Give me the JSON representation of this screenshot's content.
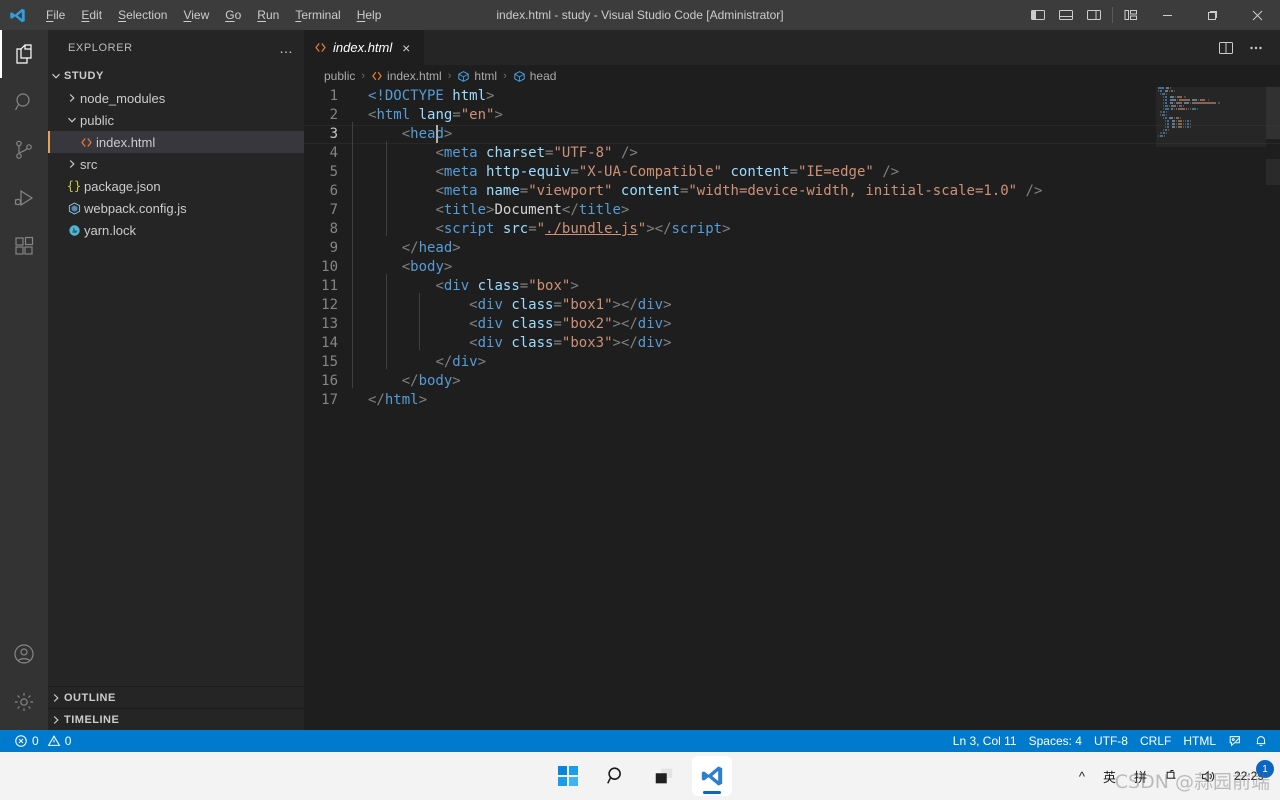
{
  "window": {
    "title": "index.html - study - Visual Studio Code [Administrator]",
    "logo": "vscode-logo"
  },
  "menu": {
    "items": [
      {
        "label": "File",
        "mnemonic": "F"
      },
      {
        "label": "Edit",
        "mnemonic": "E"
      },
      {
        "label": "Selection",
        "mnemonic": "S"
      },
      {
        "label": "View",
        "mnemonic": "V"
      },
      {
        "label": "Go",
        "mnemonic": "G"
      },
      {
        "label": "Run",
        "mnemonic": "R"
      },
      {
        "label": "Terminal",
        "mnemonic": "T"
      },
      {
        "label": "Help",
        "mnemonic": "H"
      }
    ]
  },
  "titlebar_actions": {
    "toggle_primary_sidebar": "toggle-primary-sidebar-icon",
    "toggle_panel": "toggle-panel-icon",
    "toggle_secondary_sidebar": "toggle-secondary-sidebar-icon",
    "customize_layout": "customize-layout-icon",
    "minimize": "minimize-icon",
    "maximize": "maximize-icon",
    "close": "close-icon"
  },
  "activitybar": {
    "items": [
      {
        "name": "explorer",
        "icon": "files-icon",
        "active": true
      },
      {
        "name": "search",
        "icon": "search-icon",
        "active": false
      },
      {
        "name": "source-control",
        "icon": "source-control-icon",
        "active": false
      },
      {
        "name": "run-and-debug",
        "icon": "run-debug-icon",
        "active": false
      },
      {
        "name": "extensions",
        "icon": "extensions-icon",
        "active": false
      }
    ],
    "bottom": [
      {
        "name": "accounts",
        "icon": "account-icon"
      },
      {
        "name": "settings",
        "icon": "gear-icon"
      }
    ]
  },
  "sidebar": {
    "header": "EXPLORER",
    "more_actions": "…",
    "tree": [
      {
        "label": "STUDY",
        "type": "root",
        "expanded": true,
        "indent": 0,
        "icon": "none",
        "selected": false
      },
      {
        "label": "node_modules",
        "type": "folder",
        "expanded": false,
        "indent": 1,
        "icon": "none",
        "selected": false
      },
      {
        "label": "public",
        "type": "folder",
        "expanded": true,
        "indent": 1,
        "icon": "none",
        "selected": false
      },
      {
        "label": "index.html",
        "type": "file",
        "expanded": null,
        "indent": 2,
        "icon": "html-icon",
        "selected": true
      },
      {
        "label": "src",
        "type": "folder",
        "expanded": false,
        "indent": 1,
        "icon": "none",
        "selected": false
      },
      {
        "label": "package.json",
        "type": "file",
        "expanded": null,
        "indent": 1,
        "icon": "json-icon",
        "selected": false
      },
      {
        "label": "webpack.config.js",
        "type": "file",
        "expanded": null,
        "indent": 1,
        "icon": "webpack-icon",
        "selected": false
      },
      {
        "label": "yarn.lock",
        "type": "file",
        "expanded": null,
        "indent": 1,
        "icon": "yarn-icon",
        "selected": false
      }
    ],
    "sections": [
      {
        "label": "OUTLINE",
        "expanded": false
      },
      {
        "label": "TIMELINE",
        "expanded": false
      }
    ]
  },
  "editor": {
    "tabs": [
      {
        "label": "index.html",
        "icon": "html-icon",
        "active": true,
        "preview": true,
        "close": "×"
      }
    ],
    "actions": [
      {
        "name": "split-editor-right",
        "icon": "split-editor-icon"
      },
      {
        "name": "more-actions",
        "icon": "ellipsis-icon"
      }
    ],
    "breadcrumbs": [
      {
        "label": "public",
        "icon": "none"
      },
      {
        "label": "index.html",
        "icon": "html-icon"
      },
      {
        "label": "html",
        "icon": "symbol-field-icon"
      },
      {
        "label": "head",
        "icon": "symbol-field-icon"
      }
    ],
    "code": {
      "language": "HTML",
      "cursor_line": 3,
      "lines": [
        {
          "n": 1,
          "indent": 0,
          "guides": 0,
          "tokens": [
            {
              "t": "<!DOCTYPE",
              "c": "t-doctype"
            },
            {
              "t": " ",
              "c": "t-txt"
            },
            {
              "t": "html",
              "c": "t-attr"
            },
            {
              "t": ">",
              "c": "t-punct"
            }
          ]
        },
        {
          "n": 2,
          "indent": 0,
          "guides": 0,
          "tokens": [
            {
              "t": "<",
              "c": "t-punct"
            },
            {
              "t": "html",
              "c": "t-tag"
            },
            {
              "t": " ",
              "c": "t-txt"
            },
            {
              "t": "lang",
              "c": "t-attr"
            },
            {
              "t": "=",
              "c": "t-punct"
            },
            {
              "t": "\"en\"",
              "c": "t-str"
            },
            {
              "t": ">",
              "c": "t-punct"
            }
          ]
        },
        {
          "n": 3,
          "indent": 4,
          "guides": 1,
          "tokens": [
            {
              "t": "<",
              "c": "t-punct"
            },
            {
              "t": "head",
              "c": "t-tag"
            },
            {
              "t": ">",
              "c": "t-punct"
            }
          ]
        },
        {
          "n": 4,
          "indent": 8,
          "guides": 2,
          "tokens": [
            {
              "t": "<",
              "c": "t-punct"
            },
            {
              "t": "meta",
              "c": "t-tag"
            },
            {
              "t": " ",
              "c": "t-txt"
            },
            {
              "t": "charset",
              "c": "t-attr"
            },
            {
              "t": "=",
              "c": "t-punct"
            },
            {
              "t": "\"UTF-8\"",
              "c": "t-str"
            },
            {
              "t": " ",
              "c": "t-txt"
            },
            {
              "t": "/>",
              "c": "t-punct"
            }
          ]
        },
        {
          "n": 5,
          "indent": 8,
          "guides": 2,
          "tokens": [
            {
              "t": "<",
              "c": "t-punct"
            },
            {
              "t": "meta",
              "c": "t-tag"
            },
            {
              "t": " ",
              "c": "t-txt"
            },
            {
              "t": "http-equiv",
              "c": "t-attr"
            },
            {
              "t": "=",
              "c": "t-punct"
            },
            {
              "t": "\"X-UA-Compatible\"",
              "c": "t-str"
            },
            {
              "t": " ",
              "c": "t-txt"
            },
            {
              "t": "content",
              "c": "t-attr"
            },
            {
              "t": "=",
              "c": "t-punct"
            },
            {
              "t": "\"IE=edge\"",
              "c": "t-str"
            },
            {
              "t": " ",
              "c": "t-txt"
            },
            {
              "t": "/>",
              "c": "t-punct"
            }
          ]
        },
        {
          "n": 6,
          "indent": 8,
          "guides": 2,
          "tokens": [
            {
              "t": "<",
              "c": "t-punct"
            },
            {
              "t": "meta",
              "c": "t-tag"
            },
            {
              "t": " ",
              "c": "t-txt"
            },
            {
              "t": "name",
              "c": "t-attr"
            },
            {
              "t": "=",
              "c": "t-punct"
            },
            {
              "t": "\"viewport\"",
              "c": "t-str"
            },
            {
              "t": " ",
              "c": "t-txt"
            },
            {
              "t": "content",
              "c": "t-attr"
            },
            {
              "t": "=",
              "c": "t-punct"
            },
            {
              "t": "\"width=device-width, initial-scale=1.0\"",
              "c": "t-str"
            },
            {
              "t": " ",
              "c": "t-txt"
            },
            {
              "t": "/>",
              "c": "t-punct"
            }
          ]
        },
        {
          "n": 7,
          "indent": 8,
          "guides": 2,
          "tokens": [
            {
              "t": "<",
              "c": "t-punct"
            },
            {
              "t": "title",
              "c": "t-tag"
            },
            {
              "t": ">",
              "c": "t-punct"
            },
            {
              "t": "Document",
              "c": "t-txt"
            },
            {
              "t": "</",
              "c": "t-punct"
            },
            {
              "t": "title",
              "c": "t-tag"
            },
            {
              "t": ">",
              "c": "t-punct"
            }
          ]
        },
        {
          "n": 8,
          "indent": 8,
          "guides": 2,
          "tokens": [
            {
              "t": "<",
              "c": "t-punct"
            },
            {
              "t": "script",
              "c": "t-tag"
            },
            {
              "t": " ",
              "c": "t-txt"
            },
            {
              "t": "src",
              "c": "t-attr"
            },
            {
              "t": "=",
              "c": "t-punct"
            },
            {
              "t": "\"",
              "c": "t-str"
            },
            {
              "t": "./bundle.js",
              "c": "t-link"
            },
            {
              "t": "\"",
              "c": "t-str"
            },
            {
              "t": ">",
              "c": "t-punct"
            },
            {
              "t": "</",
              "c": "t-punct"
            },
            {
              "t": "script",
              "c": "t-tag"
            },
            {
              "t": ">",
              "c": "t-punct"
            }
          ]
        },
        {
          "n": 9,
          "indent": 4,
          "guides": 1,
          "tokens": [
            {
              "t": "</",
              "c": "t-punct"
            },
            {
              "t": "head",
              "c": "t-tag"
            },
            {
              "t": ">",
              "c": "t-punct"
            }
          ]
        },
        {
          "n": 10,
          "indent": 4,
          "guides": 1,
          "tokens": [
            {
              "t": "<",
              "c": "t-punct"
            },
            {
              "t": "body",
              "c": "t-tag"
            },
            {
              "t": ">",
              "c": "t-punct"
            }
          ]
        },
        {
          "n": 11,
          "indent": 8,
          "guides": 2,
          "tokens": [
            {
              "t": "<",
              "c": "t-punct"
            },
            {
              "t": "div",
              "c": "t-tag"
            },
            {
              "t": " ",
              "c": "t-txt"
            },
            {
              "t": "class",
              "c": "t-attr"
            },
            {
              "t": "=",
              "c": "t-punct"
            },
            {
              "t": "\"box\"",
              "c": "t-str"
            },
            {
              "t": ">",
              "c": "t-punct"
            }
          ]
        },
        {
          "n": 12,
          "indent": 12,
          "guides": 3,
          "tokens": [
            {
              "t": "<",
              "c": "t-punct"
            },
            {
              "t": "div",
              "c": "t-tag"
            },
            {
              "t": " ",
              "c": "t-txt"
            },
            {
              "t": "class",
              "c": "t-attr"
            },
            {
              "t": "=",
              "c": "t-punct"
            },
            {
              "t": "\"box1\"",
              "c": "t-str"
            },
            {
              "t": ">",
              "c": "t-punct"
            },
            {
              "t": "</",
              "c": "t-punct"
            },
            {
              "t": "div",
              "c": "t-tag"
            },
            {
              "t": ">",
              "c": "t-punct"
            }
          ]
        },
        {
          "n": 13,
          "indent": 12,
          "guides": 3,
          "tokens": [
            {
              "t": "<",
              "c": "t-punct"
            },
            {
              "t": "div",
              "c": "t-tag"
            },
            {
              "t": " ",
              "c": "t-txt"
            },
            {
              "t": "class",
              "c": "t-attr"
            },
            {
              "t": "=",
              "c": "t-punct"
            },
            {
              "t": "\"box2\"",
              "c": "t-str"
            },
            {
              "t": ">",
              "c": "t-punct"
            },
            {
              "t": "</",
              "c": "t-punct"
            },
            {
              "t": "div",
              "c": "t-tag"
            },
            {
              "t": ">",
              "c": "t-punct"
            }
          ]
        },
        {
          "n": 14,
          "indent": 12,
          "guides": 3,
          "tokens": [
            {
              "t": "<",
              "c": "t-punct"
            },
            {
              "t": "div",
              "c": "t-tag"
            },
            {
              "t": " ",
              "c": "t-txt"
            },
            {
              "t": "class",
              "c": "t-attr"
            },
            {
              "t": "=",
              "c": "t-punct"
            },
            {
              "t": "\"box3\"",
              "c": "t-str"
            },
            {
              "t": ">",
              "c": "t-punct"
            },
            {
              "t": "</",
              "c": "t-punct"
            },
            {
              "t": "div",
              "c": "t-tag"
            },
            {
              "t": ">",
              "c": "t-punct"
            }
          ]
        },
        {
          "n": 15,
          "indent": 8,
          "guides": 2,
          "tokens": [
            {
              "t": "</",
              "c": "t-punct"
            },
            {
              "t": "div",
              "c": "t-tag"
            },
            {
              "t": ">",
              "c": "t-punct"
            }
          ]
        },
        {
          "n": 16,
          "indent": 4,
          "guides": 1,
          "tokens": [
            {
              "t": "</",
              "c": "t-punct"
            },
            {
              "t": "body",
              "c": "t-tag"
            },
            {
              "t": ">",
              "c": "t-punct"
            }
          ]
        },
        {
          "n": 17,
          "indent": 0,
          "guides": 0,
          "tokens": [
            {
              "t": "</",
              "c": "t-punct"
            },
            {
              "t": "html",
              "c": "t-tag"
            },
            {
              "t": ">",
              "c": "t-punct"
            }
          ]
        }
      ]
    }
  },
  "statusbar": {
    "errors": "0",
    "warnings": "0",
    "position": "Ln 3, Col 11",
    "indentation": "Spaces: 4",
    "encoding": "UTF-8",
    "eol": "CRLF",
    "language": "HTML",
    "feedback_icon": "feedback-icon",
    "bell_icon": "bell-icon",
    "background": "#007acc"
  },
  "taskbar": {
    "apps": [
      {
        "name": "start",
        "icon": "windows-start-icon",
        "active": false
      },
      {
        "name": "search",
        "icon": "search-icon",
        "active": false
      },
      {
        "name": "task-view",
        "icon": "task-view-icon",
        "active": false
      },
      {
        "name": "vscode",
        "icon": "vscode-icon",
        "active": true
      }
    ],
    "tray": {
      "show_hidden": "^",
      "ime_mode": "英",
      "ime_pinyin": "拼",
      "network_icon": "network-icon",
      "volume_icon": "volume-icon",
      "time": "22:29",
      "notification_count": "1"
    },
    "watermark": "CSDN @蒜园前端"
  }
}
